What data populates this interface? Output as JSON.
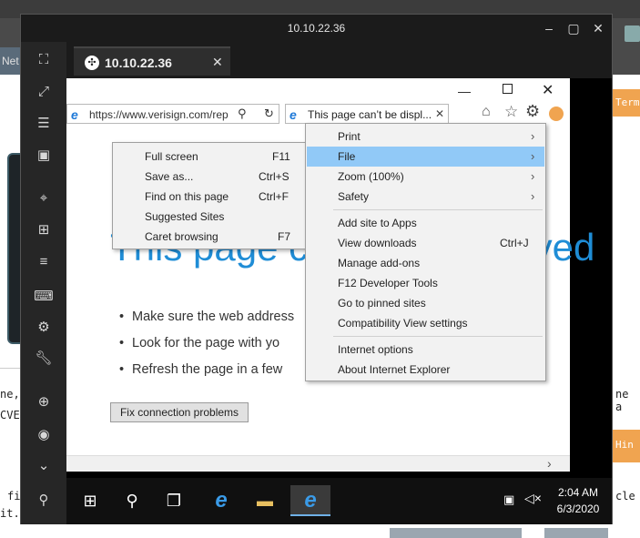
{
  "background_page": {
    "tab_fragment": "Net",
    "orange_btn1": "Term",
    "orange_btn2": "Hin",
    "text_left_1": "ne,",
    "text_left_2": "CVE",
    "text_right_1": "ne a",
    "text_left_3": "fi",
    "text_left_4": "it.",
    "text_right_2": "cle"
  },
  "remote_window": {
    "title": "10.10.22.36",
    "controls": {
      "minimize": "–",
      "maximize": "▢",
      "close": "✕"
    },
    "tab": {
      "title": "10.10.22.36",
      "close": "✕"
    },
    "sidebar_icons": [
      "fullscreen-icon",
      "expand-icon",
      "collapse-icon",
      "window-icon",
      "target-icon",
      "scale-icon",
      "menu-icon",
      "keyboard-icon",
      "settings-icon",
      "wrench-icon",
      "add-icon",
      "camera-icon",
      "chevron-down-icon",
      "link-icon"
    ]
  },
  "ie": {
    "address": "https://www.verisign.com/rep",
    "tab_title": "This page can’t be displ...",
    "heading": "This page can’t be displayed",
    "bullets": [
      "Make sure the web address",
      "Look for the page with yo",
      "Refresh the page in a few"
    ],
    "fix_button": "Fix connection problems"
  },
  "tools_menu": {
    "items": [
      {
        "label": "Print",
        "shortcut": "",
        "arrow": true
      },
      {
        "label": "File",
        "shortcut": "",
        "arrow": true,
        "highlighted": true
      },
      {
        "label": "Zoom (100%)",
        "shortcut": "",
        "arrow": true
      },
      {
        "label": "Safety",
        "shortcut": "",
        "arrow": true
      },
      {
        "label": "Add site to Apps",
        "shortcut": ""
      },
      {
        "label": "View downloads",
        "shortcut": "Ctrl+J"
      },
      {
        "label": "Manage add-ons",
        "shortcut": ""
      },
      {
        "label": "F12 Developer Tools",
        "shortcut": ""
      },
      {
        "label": "Go to pinned sites",
        "shortcut": ""
      },
      {
        "label": "Compatibility View settings",
        "shortcut": ""
      },
      {
        "label": "Internet options",
        "shortcut": ""
      },
      {
        "label": "About Internet Explorer",
        "shortcut": ""
      }
    ]
  },
  "file_submenu": {
    "items": [
      {
        "label": "Full screen",
        "shortcut": "F11"
      },
      {
        "label": "Save as...",
        "shortcut": "Ctrl+S"
      },
      {
        "label": "Find on this page",
        "shortcut": "Ctrl+F"
      },
      {
        "label": "Suggested Sites",
        "shortcut": ""
      },
      {
        "label": "Caret browsing",
        "shortcut": "F7"
      }
    ]
  },
  "taskbar": {
    "time": "2:04 AM",
    "date": "6/3/2020"
  }
}
